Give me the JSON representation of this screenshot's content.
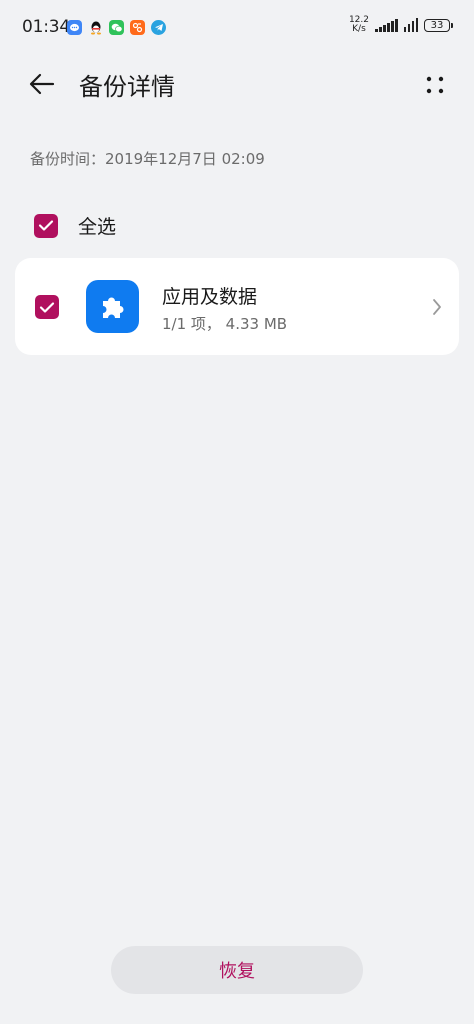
{
  "status_bar": {
    "time": "01:34",
    "net_speed_value": "12.2",
    "net_speed_unit": "K/s",
    "battery": "33",
    "notification_icons": [
      "message-icon",
      "qq-icon",
      "wechat-icon",
      "app-icon",
      "telegram-icon"
    ]
  },
  "app_bar": {
    "title": "备份详情"
  },
  "backup_time": "备份时间：2019年12月7日 02:09",
  "select_all": {
    "label": "全选",
    "checked": true
  },
  "items": [
    {
      "title": "应用及数据",
      "subtitle": "1/1 项， 4.33 MB",
      "checked": true,
      "icon": "puzzle-icon"
    }
  ],
  "restore_button": {
    "label": "恢复"
  },
  "colors": {
    "accent": "#b0105e",
    "background": "#f1f2f4",
    "card": "#ffffff",
    "app_icon_bg": "#0f7bf0",
    "button_bg": "#e3e4e7"
  }
}
